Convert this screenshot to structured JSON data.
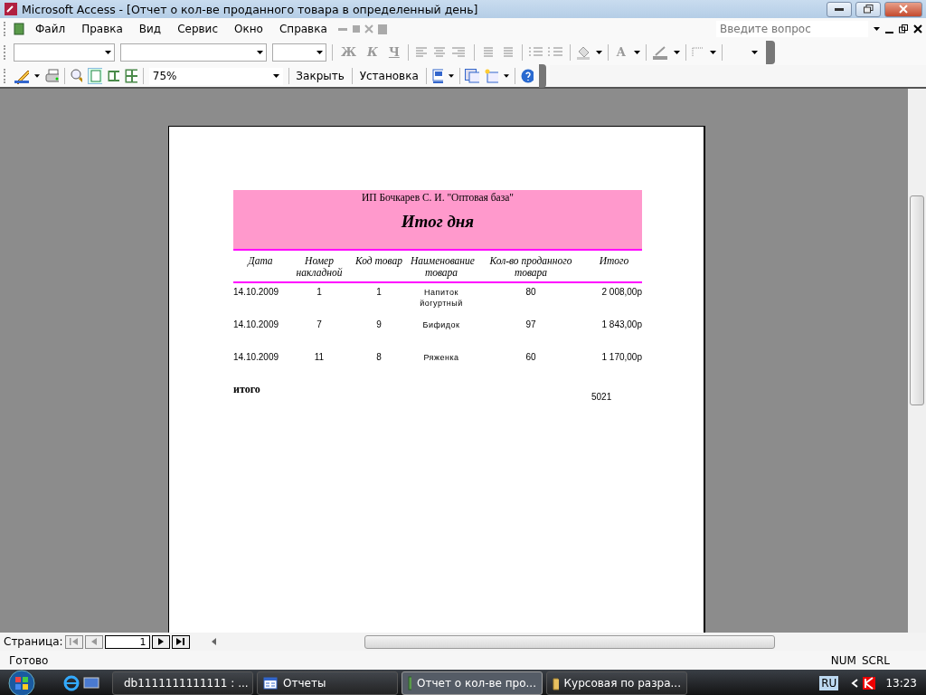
{
  "window": {
    "title": "Microsoft Access - [Отчет о кол-ве проданного товара в определенный день]"
  },
  "menu": {
    "items": [
      "Файл",
      "Правка",
      "Вид",
      "Сервис",
      "Окно",
      "Справка"
    ],
    "question_placeholder": "Введите вопрос"
  },
  "format_toolbar": {
    "style_buttons": [
      "Ж",
      "К",
      "Ч"
    ],
    "font_color_button": "A"
  },
  "preview_toolbar": {
    "zoom": "75%",
    "buttons": [
      "Закрыть",
      "Установка"
    ]
  },
  "report": {
    "company": "ИП Бочкарев С. И. \"Оптовая база\"",
    "title": "Итог дня",
    "columns": [
      "Дата",
      "Номер накладной",
      "Код товар",
      "Наименование товара",
      "Кол-во проданного товара",
      "Итого"
    ],
    "rows": [
      [
        "14.10.2009",
        "1",
        "1",
        "Напиток йогуртный",
        "80",
        "2 008,00р"
      ],
      [
        "14.10.2009",
        "7",
        "9",
        "Бифидок",
        "97",
        "1 843,00р"
      ],
      [
        "14.10.2009",
        "11",
        "8",
        "Ряженка",
        "60",
        "1 170,00р"
      ]
    ],
    "total_label": "итого",
    "total_value": "5021"
  },
  "navigation": {
    "label": "Страница:",
    "page": "1"
  },
  "status_bar": {
    "text": "Готово",
    "indicators": [
      "NUM",
      "SCRL"
    ]
  },
  "taskbar": {
    "tasks": [
      {
        "label": "db1111111111111 : ...",
        "kind": "database",
        "selected": false
      },
      {
        "label": "Отчеты",
        "kind": "form",
        "selected": false
      },
      {
        "label": "Отчет о кол-ве про...",
        "kind": "report",
        "selected": true
      },
      {
        "label": "Курсовая по разра...",
        "kind": "folder",
        "selected": false
      }
    ],
    "language": "RU",
    "clock": "13:23"
  }
}
